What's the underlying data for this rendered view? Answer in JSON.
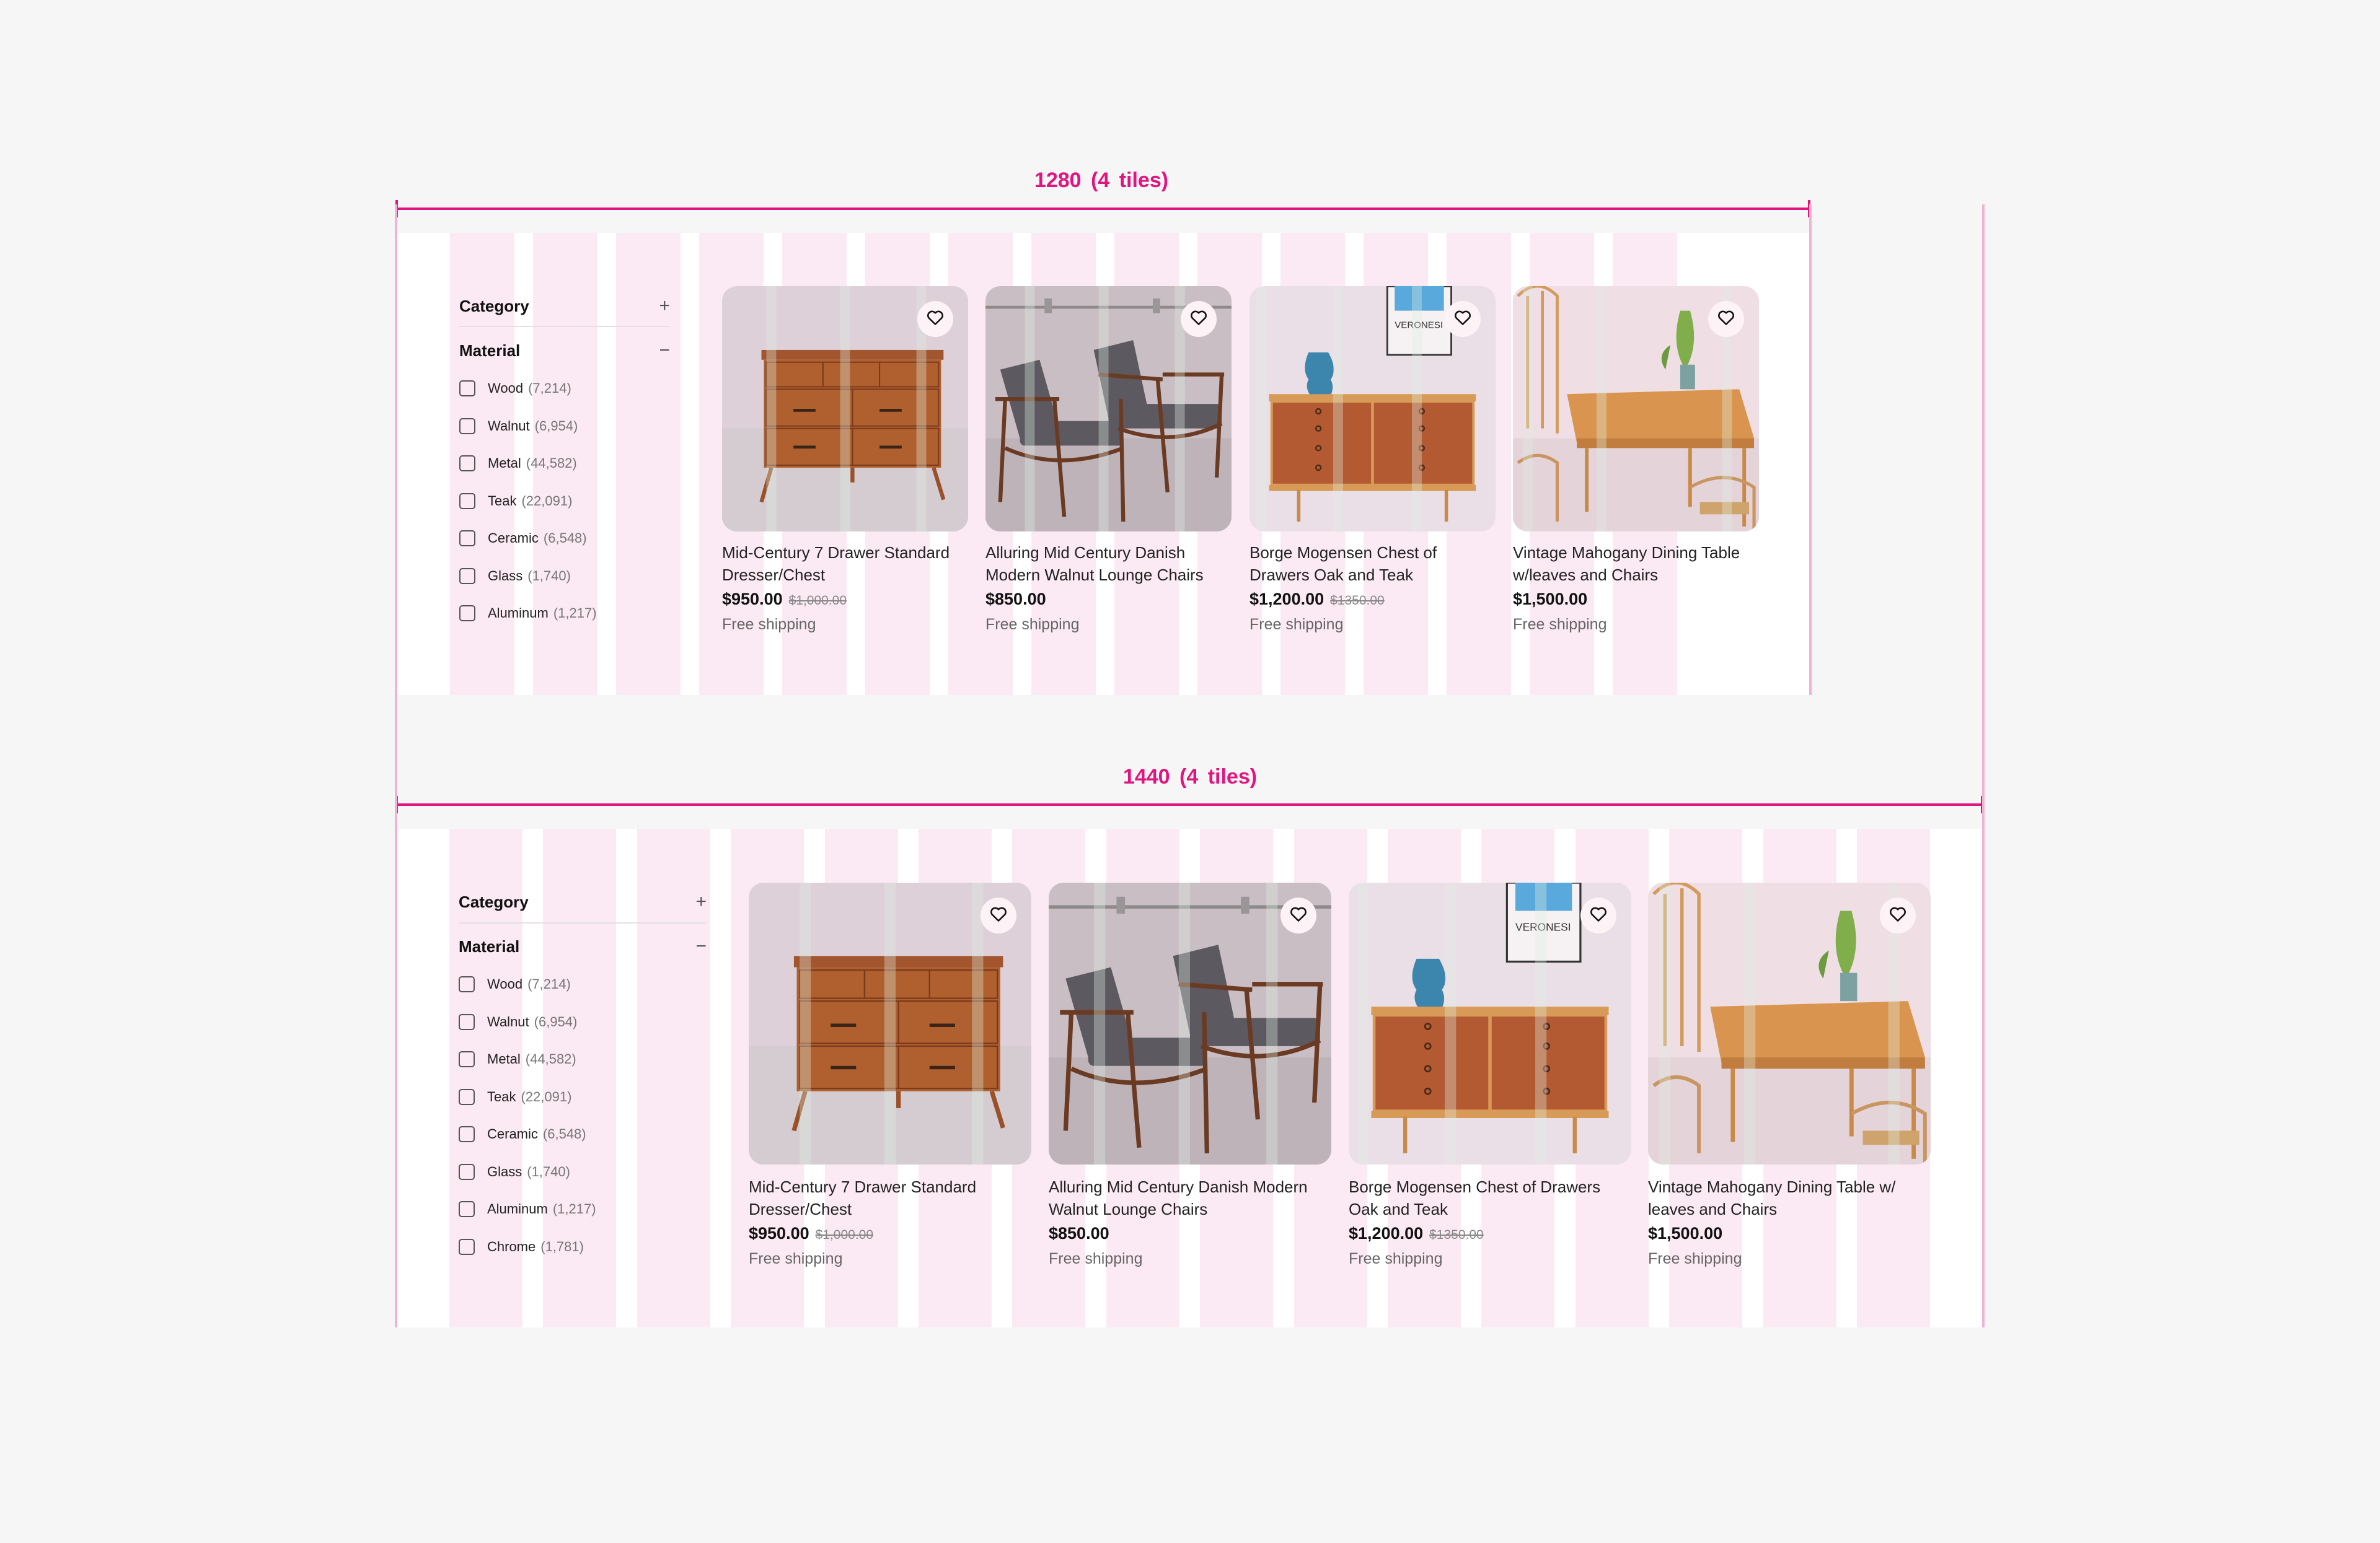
{
  "annotations": {
    "top_label": "1280  (4 tiles)",
    "bottom_label": "1440  (4 tiles)",
    "accent_color": "#e0157f",
    "grid_tint": "#fbeaf3"
  },
  "layouts": [
    {
      "id": "1280",
      "sidebar": {
        "category": {
          "label": "Category",
          "toggle": "+"
        },
        "material": {
          "label": "Material",
          "toggle": "−"
        },
        "options": [
          {
            "label": "Wood",
            "count": "(7,214)"
          },
          {
            "label": "Walnut",
            "count": "(6,954)"
          },
          {
            "label": "Metal",
            "count": "(44,582)"
          },
          {
            "label": "Teak",
            "count": "(22,091)"
          },
          {
            "label": "Ceramic",
            "count": "(6,548)"
          },
          {
            "label": "Glass",
            "count": "(1,740)"
          },
          {
            "label": "Aluminum",
            "count": "(1,217)"
          }
        ]
      }
    },
    {
      "id": "1440",
      "sidebar": {
        "category": {
          "label": "Category",
          "toggle": "+"
        },
        "material": {
          "label": "Material",
          "toggle": "−"
        },
        "options": [
          {
            "label": "Wood",
            "count": "(7,214)"
          },
          {
            "label": "Walnut",
            "count": "(6,954)"
          },
          {
            "label": "Metal",
            "count": "(44,582)"
          },
          {
            "label": "Teak",
            "count": "(22,091)"
          },
          {
            "label": "Ceramic",
            "count": "(6,548)"
          },
          {
            "label": "Glass",
            "count": "(1,740)"
          },
          {
            "label": "Aluminum",
            "count": "(1,217)"
          },
          {
            "label": "Chrome",
            "count": "(1,781)"
          }
        ]
      }
    }
  ],
  "products": [
    {
      "title": "Mid-Century 7 Drawer Standard Dresser/Chest",
      "price": "$950.00",
      "original_price": "$1,000.00",
      "shipping": "Free shipping",
      "image": "dresser",
      "favorite_icon": "heart-outline"
    },
    {
      "title": "Alluring Mid Century Danish Modern Walnut Lounge Chairs",
      "price": "$850.00",
      "original_price": "",
      "shipping": "Free shipping",
      "image": "lounge-chairs",
      "favorite_icon": "heart-outline"
    },
    {
      "title": "Borge Mogensen Chest of Drawers Oak and Teak",
      "price": "$1,200.00",
      "original_price": "$1350.00",
      "shipping": "Free shipping",
      "image": "chest-of-drawers",
      "poster_text": "VERONESI",
      "favorite_icon": "heart-outline"
    },
    {
      "title": "Vintage Mahogany Dining Table w/leaves and Chairs",
      "price": "$1,500.00",
      "original_price": "",
      "shipping": "Free shipping",
      "image": "dining-set",
      "favorite_icon": "heart-outline"
    }
  ],
  "products_1440_titles": [
    "Mid-Century 7 Drawer Standard Dresser/Chest",
    "Alluring Mid Century Danish Modern Walnut Lounge Chairs",
    "Borge Mogensen Chest of Drawers Oak and Teak",
    "Vintage Mahogany Dining Table w/ leaves and Chairs"
  ]
}
